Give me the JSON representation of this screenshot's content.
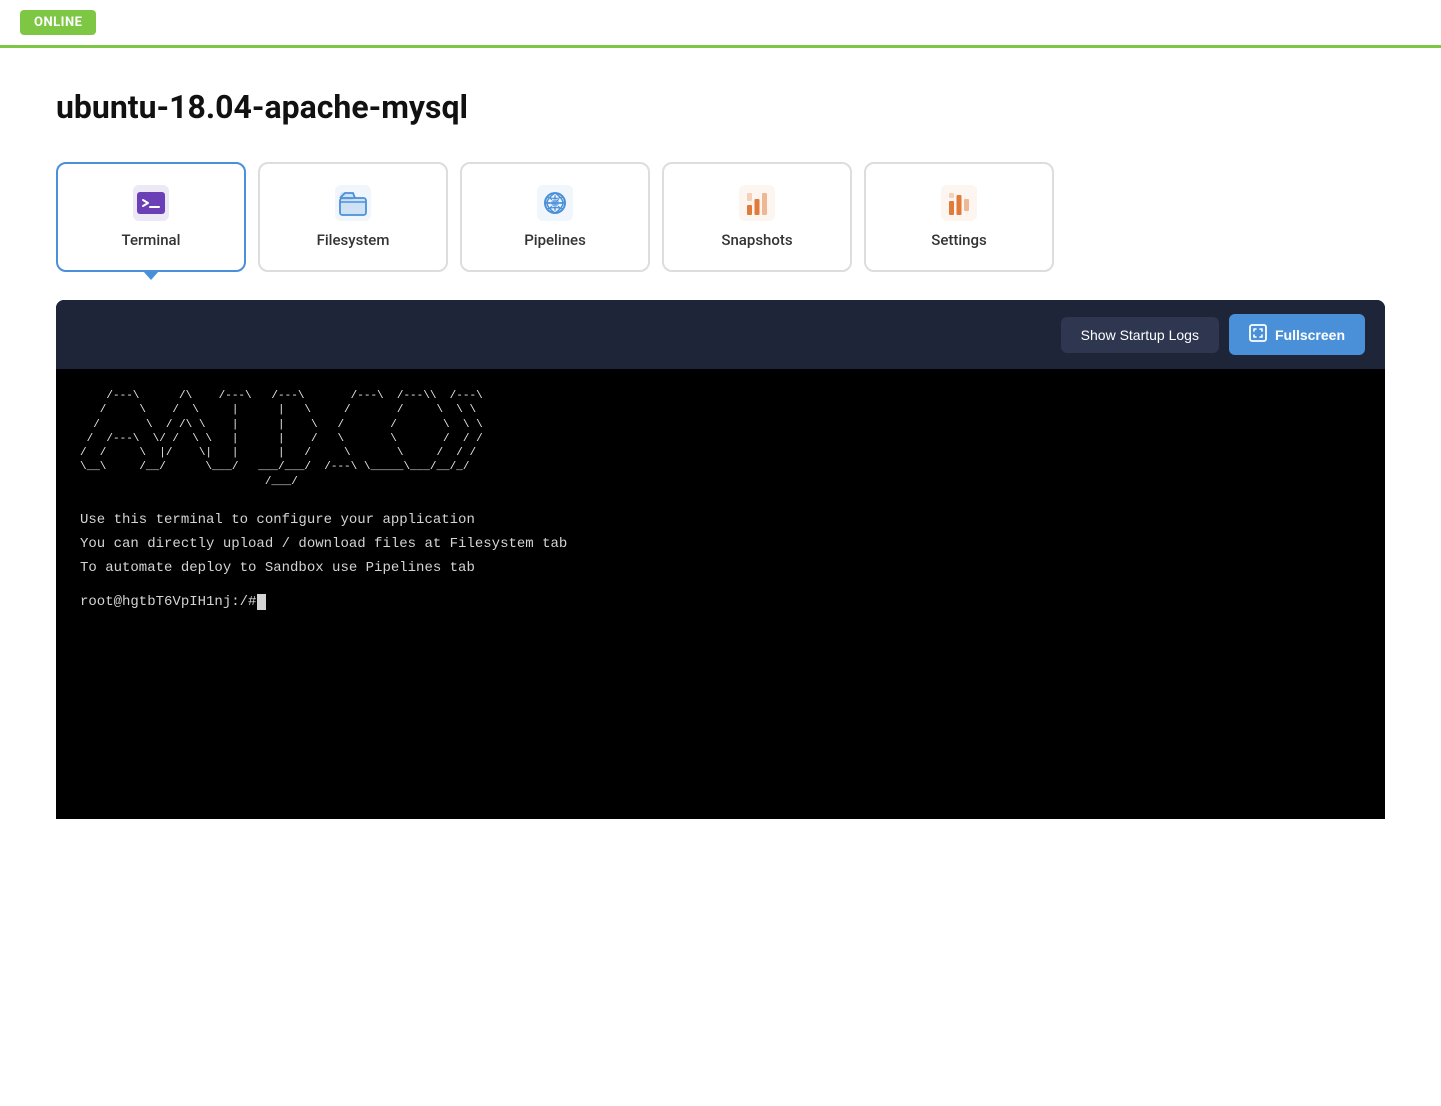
{
  "topbar": {
    "status_label": "ONLINE"
  },
  "page": {
    "title": "ubuntu-18.04-apache-mysql"
  },
  "tabs": [
    {
      "id": "terminal",
      "label": "Terminal",
      "active": true,
      "icon": "terminal-icon"
    },
    {
      "id": "filesystem",
      "label": "Filesystem",
      "active": false,
      "icon": "filesystem-icon"
    },
    {
      "id": "pipelines",
      "label": "Pipelines",
      "active": false,
      "icon": "pipelines-icon"
    },
    {
      "id": "snapshots",
      "label": "Snapshots",
      "active": false,
      "icon": "snapshots-icon"
    },
    {
      "id": "settings",
      "label": "Settings",
      "active": false,
      "icon": "settings-icon"
    }
  ],
  "terminal": {
    "show_logs_label": "Show Startup Logs",
    "fullscreen_label": "Fullscreen",
    "ascii_art": "  /---\\      /---\\ /---\\ /---\\          /---\\ /---\\\\ /---\\\n /     \\    /       |     |   \\        /       /     \\  \\ \\\n/       \\  /        |     |    \\      /       /       \\  \\ \\\n\\        \\/  /---\\  |     |    /      \\       \\       /  / /\n \\       /  /     \\ |     |   /        \\       \\     /  / /\n  \\-----/  /-------\\|_____/__/    /---/ \\-------\\---/__/_/",
    "info_lines": "Use this terminal to configure your application\nYou can directly upload / download files at Filesystem tab\nTo automate deploy to Sandbox use Pipelines tab",
    "prompt": "root@hgtbT6VpIH1nj:/#"
  }
}
